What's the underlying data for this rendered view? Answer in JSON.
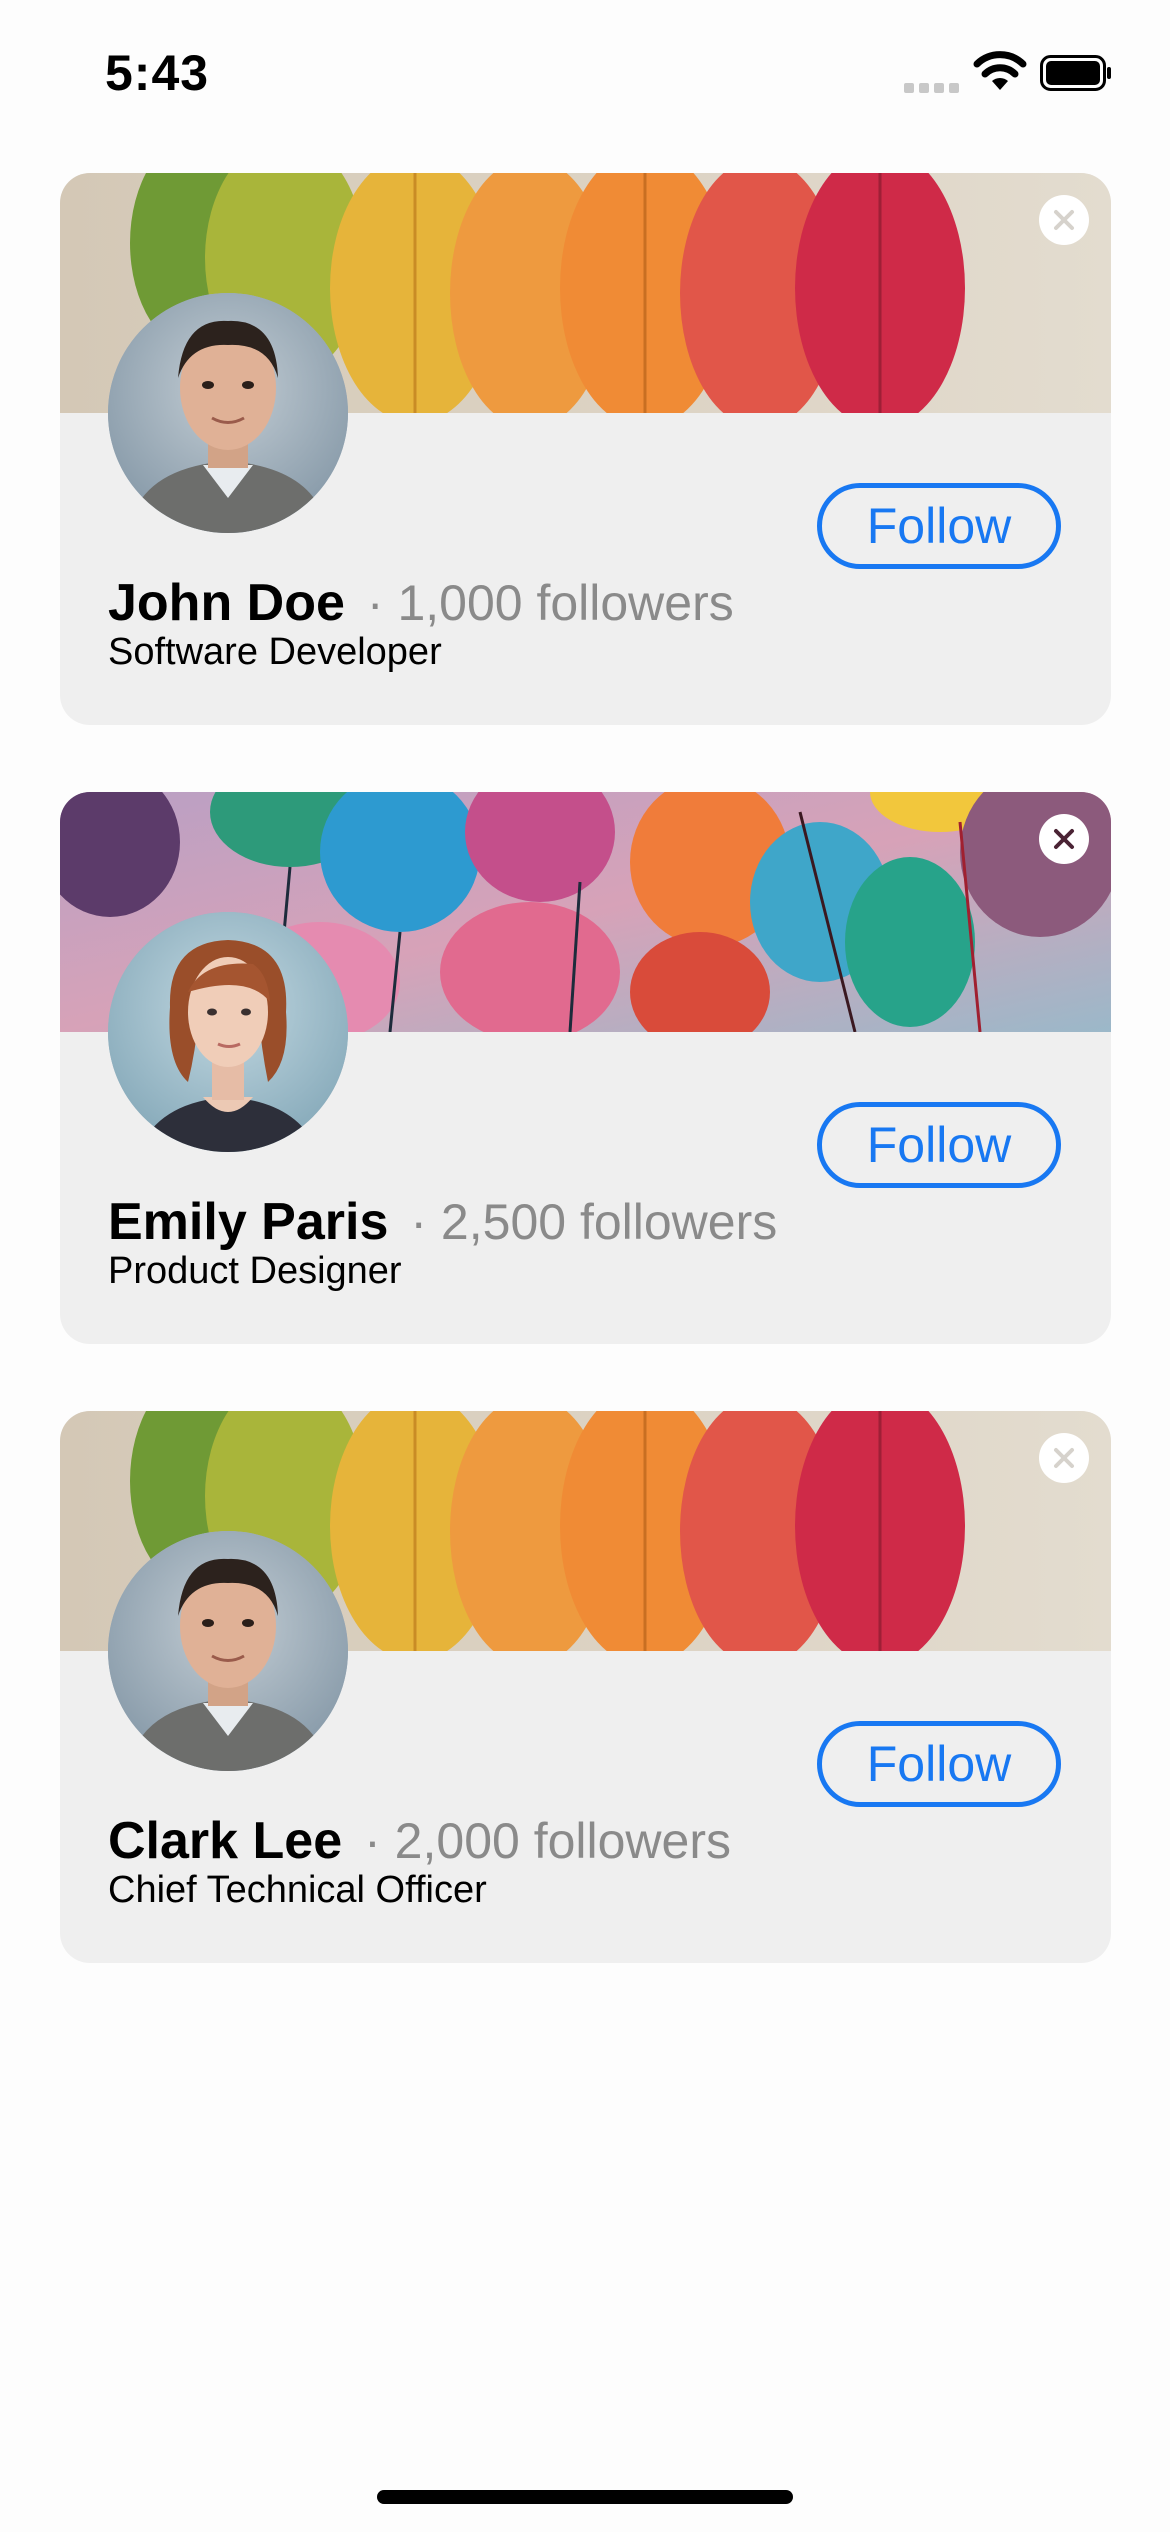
{
  "status_bar": {
    "time": "5:43",
    "icons": [
      "cellular-signal-icon",
      "wifi-icon",
      "battery-icon"
    ]
  },
  "cards": [
    {
      "name": "John Doe",
      "followers": "· 1,000 followers",
      "title": "Software Developer",
      "follow_label": "Follow",
      "banner": "autumn-leaves",
      "avatar": "man-portrait",
      "close_icon_style": "light"
    },
    {
      "name": "Emily Paris",
      "followers": "· 2,500 followers",
      "title": "Product Designer",
      "follow_label": "Follow",
      "banner": "balloons",
      "avatar": "woman-portrait",
      "close_icon_style": "dark"
    },
    {
      "name": "Clark Lee",
      "followers": "· 2,000 followers",
      "title": "Chief Technical Officer",
      "follow_label": "Follow",
      "banner": "autumn-leaves",
      "avatar": "man-portrait",
      "close_icon_style": "light"
    }
  ],
  "colors": {
    "accent": "#1878f2",
    "card_background": "#efefef",
    "secondary_text": "#8a8a8a"
  }
}
